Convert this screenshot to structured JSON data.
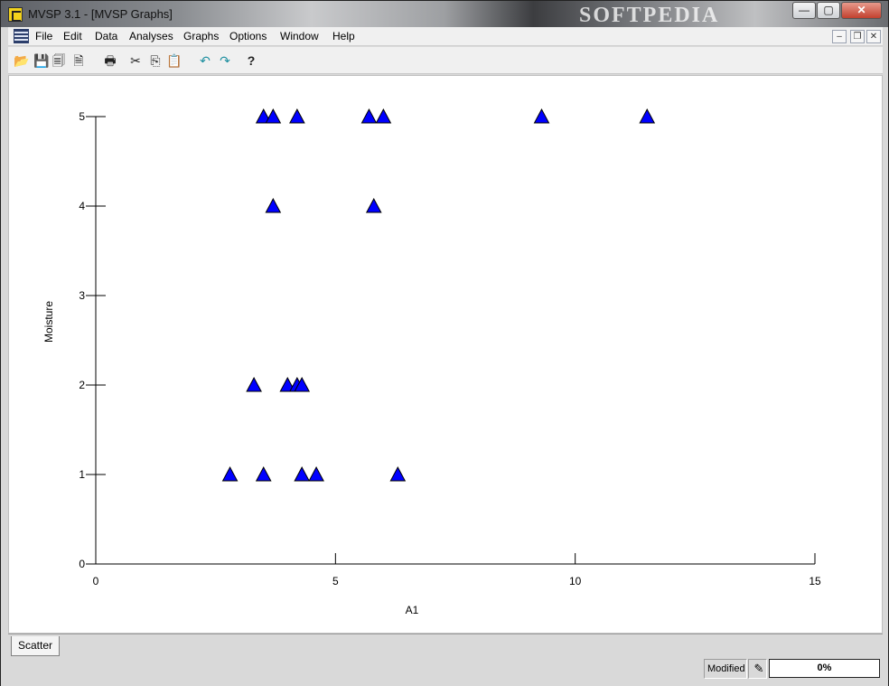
{
  "window": {
    "title": "MVSP 3.1 - [MVSP Graphs]",
    "watermark": "SOFTPEDIA",
    "controls": {
      "minimize": "—",
      "maximize": "▢",
      "close": "✕"
    }
  },
  "menu": {
    "items": [
      "File",
      "Edit",
      "Data",
      "Analyses",
      "Graphs",
      "Options",
      "Window",
      "Help"
    ],
    "mdi": {
      "minimize": "–",
      "restore": "❐",
      "close": "✕"
    }
  },
  "toolbar": {
    "tools": [
      {
        "name": "open-icon",
        "glyph": "📂"
      },
      {
        "name": "save-icon",
        "glyph": "💾"
      },
      {
        "name": "save-all-icon",
        "glyph": "🗐"
      },
      {
        "name": "export-icon",
        "glyph": "🗎"
      },
      {
        "name": "print-icon",
        "glyph": "🖶"
      },
      {
        "name": "cut-icon",
        "glyph": "✂"
      },
      {
        "name": "copy-icon",
        "glyph": "⎘"
      },
      {
        "name": "paste-icon",
        "glyph": "📋"
      },
      {
        "name": "undo-icon",
        "glyph": "↶"
      },
      {
        "name": "redo-icon",
        "glyph": "↷"
      },
      {
        "name": "help-icon",
        "glyph": "?"
      }
    ]
  },
  "chart_data": {
    "type": "scatter",
    "title": "",
    "xlabel": "A1",
    "ylabel": "Moisture",
    "xlim": [
      0,
      15
    ],
    "ylim": [
      0,
      5
    ],
    "xticks": [
      0,
      5,
      10,
      15
    ],
    "yticks": [
      0,
      1,
      2,
      3,
      4,
      5
    ],
    "marker": "triangle",
    "marker_color": "#0000ff",
    "grid": false,
    "points": [
      {
        "x": 3.5,
        "y": 5
      },
      {
        "x": 3.7,
        "y": 5
      },
      {
        "x": 4.2,
        "y": 5
      },
      {
        "x": 5.7,
        "y": 5
      },
      {
        "x": 6.0,
        "y": 5
      },
      {
        "x": 9.3,
        "y": 5
      },
      {
        "x": 11.5,
        "y": 5
      },
      {
        "x": 3.7,
        "y": 4
      },
      {
        "x": 5.8,
        "y": 4
      },
      {
        "x": 3.3,
        "y": 2
      },
      {
        "x": 4.0,
        "y": 2
      },
      {
        "x": 4.2,
        "y": 2
      },
      {
        "x": 4.3,
        "y": 2
      },
      {
        "x": 2.8,
        "y": 1
      },
      {
        "x": 3.5,
        "y": 1
      },
      {
        "x": 4.3,
        "y": 1
      },
      {
        "x": 4.6,
        "y": 1
      },
      {
        "x": 6.3,
        "y": 1
      }
    ]
  },
  "tabs": {
    "active": "Scatter"
  },
  "status": {
    "state": "Modified",
    "progress": "0%"
  }
}
